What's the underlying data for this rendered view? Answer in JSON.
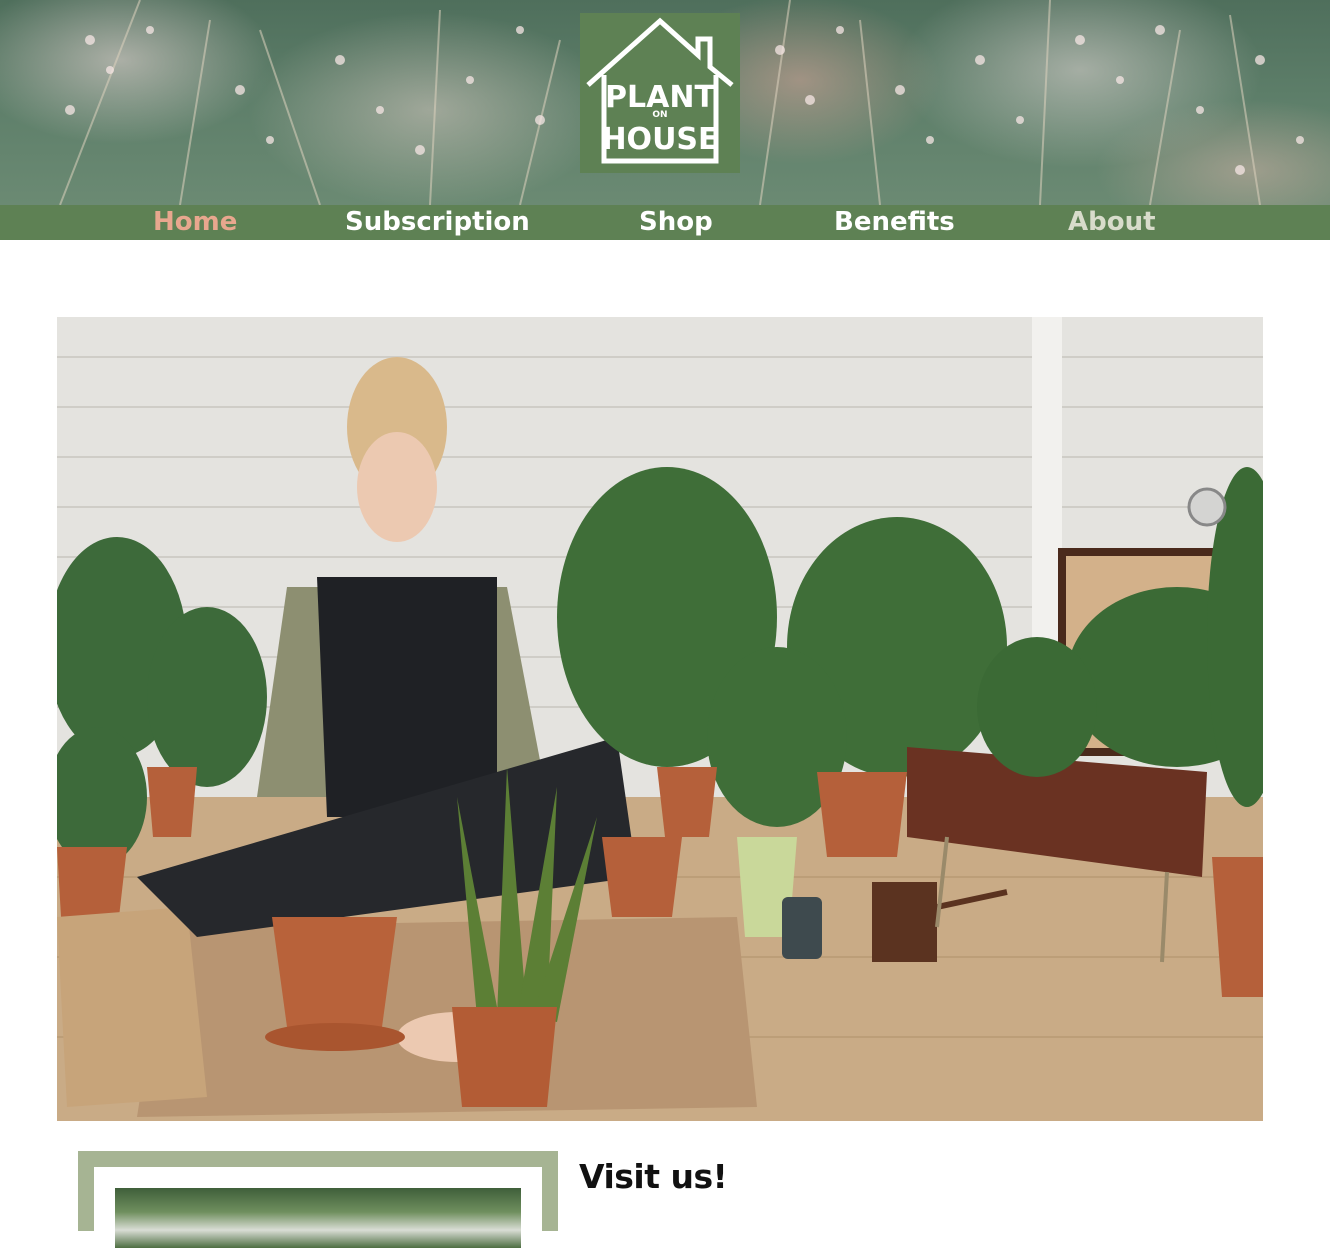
{
  "brand": {
    "logo_line1": "PLANT",
    "logo_line2": "HOUSE",
    "logo_connector": "ON",
    "logo_color": "#5e8154"
  },
  "nav": {
    "items": [
      {
        "label": "Home",
        "state": "active"
      },
      {
        "label": "Subscription",
        "state": "normal"
      },
      {
        "label": "Shop",
        "state": "normal"
      },
      {
        "label": "Benefits",
        "state": "normal"
      },
      {
        "label": "About",
        "state": "muted"
      }
    ],
    "bar_color": "#5e8154",
    "active_color": "#e8a78e"
  },
  "hero": {
    "image_description_icon": "hero-photo"
  },
  "visit": {
    "heading": "Visit us!"
  },
  "colors": {
    "card_border": "#a6b493",
    "heading_text": "#111111"
  }
}
